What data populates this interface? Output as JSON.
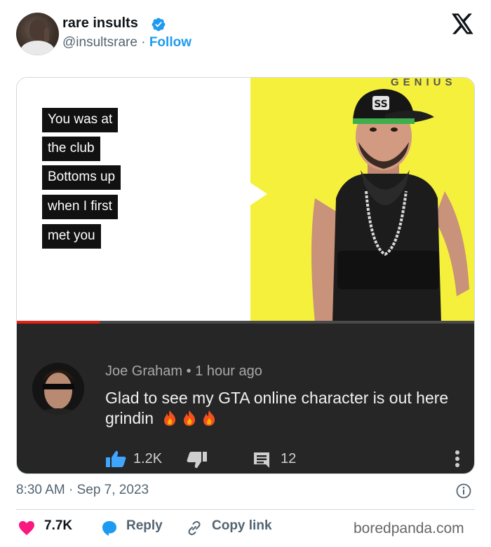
{
  "tweet": {
    "author_name": "rare insults",
    "handle": "@insultsrare",
    "separator": " · ",
    "follow_label": "Follow",
    "timestamp": "8:30 AM · Sep 7, 2023"
  },
  "video": {
    "brand": "GENIUS",
    "lyrics": [
      "You was at",
      "the club",
      "Bottoms up",
      "when I first",
      "met you"
    ],
    "progress": 0.18,
    "accent_color": "#f5f03c",
    "progress_color": "#e62117"
  },
  "comment": {
    "author": "Joe Graham",
    "time": "1 hour ago",
    "text": "Glad to see my GTA online character is out here grindin",
    "emoji": [
      "fire",
      "fire",
      "fire"
    ],
    "likes": "1.2K",
    "replies": "12"
  },
  "actions": {
    "likes": "7.7K",
    "reply_label": "Reply",
    "copy_link_label": "Copy link"
  },
  "watermark": "boredpanda.com",
  "colors": {
    "link_blue": "#1d9bf0",
    "heart_red": "#f91880",
    "text_gray": "#536471"
  }
}
